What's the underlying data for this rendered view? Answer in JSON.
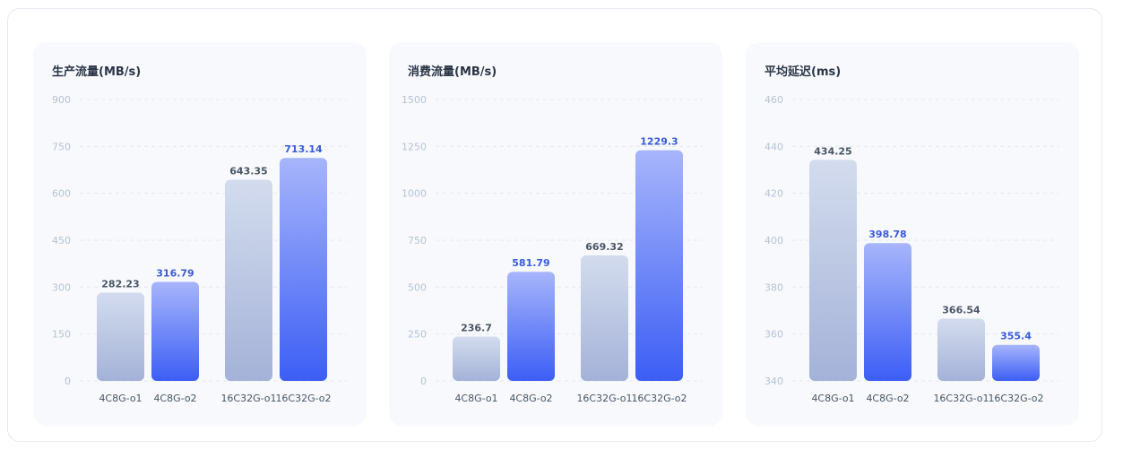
{
  "colors": {
    "grey_top": "#d3dcee",
    "grey_bottom": "#a4b2d8",
    "blue_top": "#a7b5fb",
    "blue_bottom": "#3c5ef5",
    "grey_label": "#4b5563",
    "blue_label": "#3b5bdb",
    "grid": "#e3e7ef"
  },
  "chart_data": [
    {
      "type": "bar",
      "title": "生产流量(MB/s)",
      "categories": [
        "4C8G-o1",
        "4C8G-o2",
        "16C32G-o1",
        "16C32G-o2"
      ],
      "values": [
        282.23,
        316.79,
        643.35,
        713.14
      ],
      "value_labels": [
        "282.23",
        "316.79",
        "643.35",
        "713.14"
      ],
      "ylim": [
        0,
        900
      ],
      "yticks": [
        0,
        150,
        300,
        450,
        600,
        750,
        900
      ],
      "grid": true
    },
    {
      "type": "bar",
      "title": "消费流量(MB/s)",
      "categories": [
        "4C8G-o1",
        "4C8G-o2",
        "16C32G-o1",
        "16C32G-o2"
      ],
      "values": [
        236.7,
        581.79,
        669.32,
        1229.3
      ],
      "value_labels": [
        "236.7",
        "581.79",
        "669.32",
        "1229.3"
      ],
      "ylim": [
        0,
        1500
      ],
      "yticks": [
        0,
        250,
        500,
        750,
        1000,
        1250,
        1500
      ],
      "grid": true
    },
    {
      "type": "bar",
      "title": "平均延迟(ms)",
      "categories": [
        "4C8G-o1",
        "4C8G-o2",
        "16C32G-o1",
        "16C32G-o2"
      ],
      "values": [
        434.25,
        398.78,
        366.54,
        355.4
      ],
      "value_labels": [
        "434.25",
        "398.78",
        "366.54",
        "355.4"
      ],
      "ylim": [
        340,
        460
      ],
      "yticks": [
        340,
        360,
        380,
        400,
        420,
        440,
        460
      ],
      "grid": true
    }
  ]
}
